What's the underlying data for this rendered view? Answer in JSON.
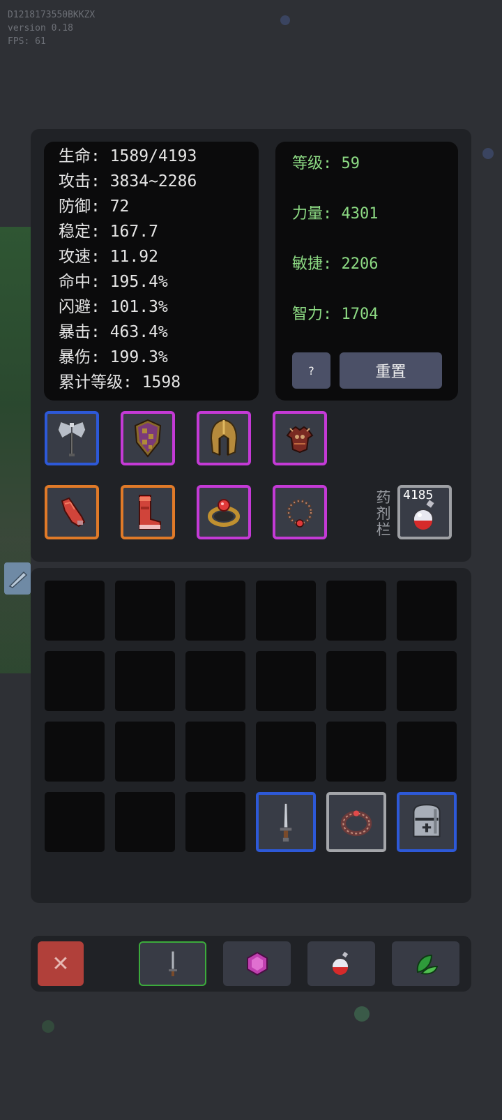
{
  "debug": {
    "id": "D1218173550BKKZX",
    "version": "version 0.18",
    "fps": "FPS: 61"
  },
  "stats": [
    {
      "label": "生命",
      "value": "1589/4193"
    },
    {
      "label": "攻击",
      "value": "3834~2286"
    },
    {
      "label": "防御",
      "value": "72"
    },
    {
      "label": "稳定",
      "value": "167.7"
    },
    {
      "label": "攻速",
      "value": "11.92"
    },
    {
      "label": "命中",
      "value": "195.4%"
    },
    {
      "label": "闪避",
      "value": "101.3%"
    },
    {
      "label": "暴击",
      "value": "463.4%"
    },
    {
      "label": "暴伤",
      "value": "199.3%"
    },
    {
      "label": "累计等级",
      "value": "1598"
    }
  ],
  "stat_lines": [
    "生命: 1589/4193",
    "攻击: 3834~2286",
    "防御: 72",
    "稳定: 167.7",
    "攻速: 11.92",
    "命中: 195.4%",
    "闪避: 101.3%",
    "暴击: 463.4%",
    "暴伤: 199.3%",
    "累计等级: 1598"
  ],
  "attributes": [
    "等级: 59",
    "力量: 4301",
    "敏捷: 2206",
    "智力: 1704"
  ],
  "buttons": {
    "help": "?",
    "reset": "重置",
    "close": "✕"
  },
  "equipment": [
    {
      "slot": "weapon",
      "item": "battle-axe",
      "rarity": "blue"
    },
    {
      "slot": "shield",
      "item": "checkered-shield",
      "rarity": "purple"
    },
    {
      "slot": "helmet",
      "item": "golden-spartan-helmet",
      "rarity": "purple"
    },
    {
      "slot": "armor",
      "item": "demon-armor",
      "rarity": "purple"
    },
    {
      "slot": "gloves",
      "item": "red-gauntlet",
      "rarity": "orange"
    },
    {
      "slot": "boots",
      "item": "red-boots",
      "rarity": "orange"
    },
    {
      "slot": "ring",
      "item": "gold-ring",
      "rarity": "purple"
    },
    {
      "slot": "necklace",
      "item": "amulet",
      "rarity": "purple"
    }
  ],
  "potion": {
    "label": "药剂栏",
    "count": "4185",
    "icon": "red-potion-icon"
  },
  "inventory": {
    "rows": 4,
    "cols": 6,
    "items": [
      {
        "row": 3,
        "col": 3,
        "icon": "sword-icon",
        "rarity": "blue"
      },
      {
        "row": 3,
        "col": 4,
        "icon": "ring-icon",
        "rarity": "gray"
      },
      {
        "row": 3,
        "col": 5,
        "icon": "knight-helmet-icon",
        "rarity": "blue"
      }
    ]
  },
  "filters": [
    {
      "name": "weapon",
      "icon": "dagger-icon",
      "active": true
    },
    {
      "name": "gem",
      "icon": "pink-gem-icon",
      "active": false
    },
    {
      "name": "potion",
      "icon": "potion-icon",
      "active": false
    },
    {
      "name": "herb",
      "icon": "green-leaf-icon",
      "active": false
    }
  ],
  "colors": {
    "rarity_blue": "#2d59d8",
    "rarity_purple": "#c43ad6",
    "rarity_orange": "#e07a28",
    "rarity_gray": "#9ea0a4",
    "attribute_text": "#8ddb84",
    "close_button": "#b1403a",
    "active_filter": "#3cab3c"
  }
}
